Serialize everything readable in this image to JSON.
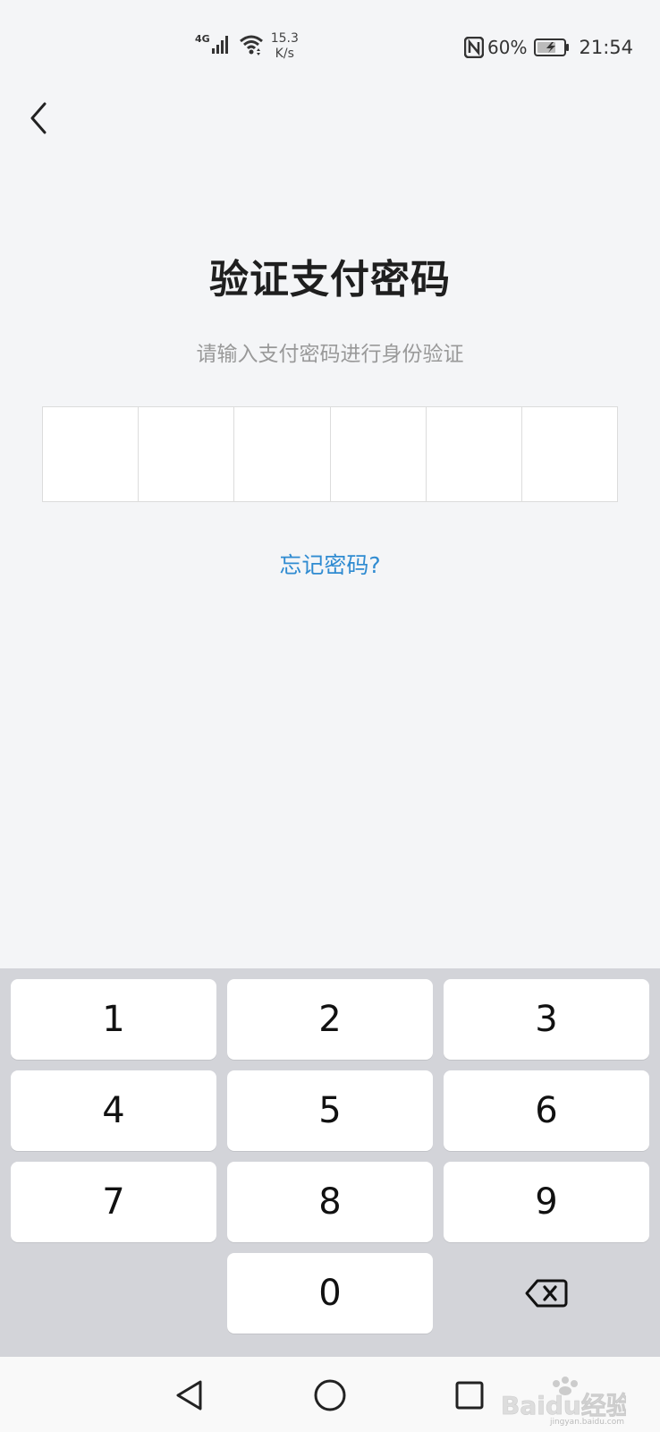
{
  "status_bar": {
    "network_type": "4G",
    "speed_value": "15.3",
    "speed_unit": "K/s",
    "battery_percent": "60%",
    "time": "21:54"
  },
  "header": {
    "back_icon": "chevron-left-icon"
  },
  "main": {
    "title": "验证支付密码",
    "subtitle": "请输入支付密码进行身份验证",
    "pin_length": 6,
    "forgot_link": "忘记密码?"
  },
  "keypad": {
    "keys": [
      "1",
      "2",
      "3",
      "4",
      "5",
      "6",
      "7",
      "8",
      "9",
      "",
      "0"
    ],
    "delete_icon": "backspace-icon"
  },
  "nav_bar": {
    "back_icon": "triangle-back-icon",
    "home_icon": "circle-home-icon",
    "recents_icon": "square-recents-icon"
  },
  "watermark": {
    "text": "Baidu经验",
    "url": "jingyan.baidu.com"
  },
  "colors": {
    "background": "#f4f5f7",
    "link": "#2f8bd1",
    "keypad_bg": "#d3d4d9"
  }
}
